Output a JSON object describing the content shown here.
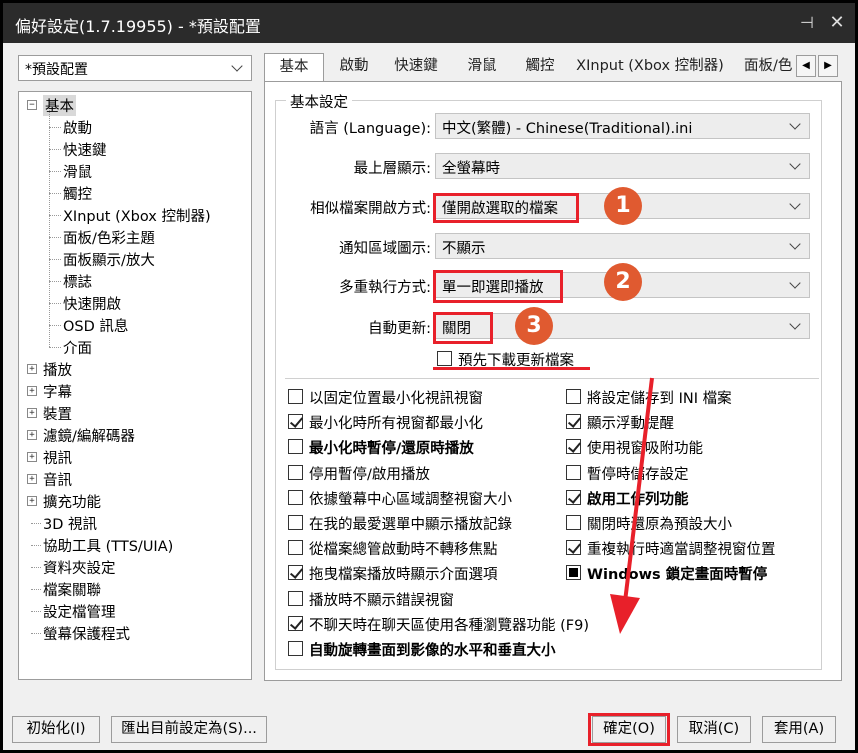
{
  "window": {
    "title": "偏好設定(1.7.19955) - *預設配置",
    "pin_glyph": "⊣",
    "close_glyph": "✕"
  },
  "profile": {
    "value": "*預設配置"
  },
  "tree": {
    "root": "基本",
    "children": [
      "啟動",
      "快速鍵",
      "滑鼠",
      "觸控",
      "XInput (Xbox 控制器)",
      "面板/色彩主題",
      "面板顯示/放大",
      "標誌",
      "快速開啟",
      "OSD 訊息",
      "介面"
    ],
    "expandable": [
      "播放",
      "字幕",
      "裝置",
      "濾鏡/編解碼器",
      "視訊",
      "音訊",
      "擴充功能"
    ],
    "leaves": [
      "3D 視訊",
      "協助工具 (TTS/UIA)",
      "資料夾設定",
      "檔案關聯",
      "設定檔管理",
      "螢幕保護程式"
    ]
  },
  "tabs": [
    "基本",
    "啟動",
    "快速鍵",
    "滑鼠",
    "觸控",
    "XInput (Xbox 控制器)",
    "面板/色"
  ],
  "tab_arrows": {
    "left": "◀",
    "right": "▶"
  },
  "group_title": "基本設定",
  "form": [
    {
      "label": "語言 (Language):",
      "value": "中文(繁體) - Chinese(Traditional).ini"
    },
    {
      "label": "最上層顯示:",
      "value": "全螢幕時"
    },
    {
      "label": "相似檔案開啟方式:",
      "value": "僅開啟選取的檔案"
    },
    {
      "label": "通知區域圖示:",
      "value": "不顯示"
    },
    {
      "label": "多重執行方式:",
      "value": "單一即選即播放"
    },
    {
      "label": "自動更新:",
      "value": "關閉"
    }
  ],
  "predownload": {
    "label": "預先下載更新檔案",
    "checked": false
  },
  "checkboxes_left": [
    {
      "label": "以固定位置最小化視訊視窗",
      "state": "unchecked",
      "bold": false
    },
    {
      "label": "最小化時所有視窗都最小化",
      "state": "checked",
      "bold": false
    },
    {
      "label": "最小化時暫停/還原時播放",
      "state": "unchecked",
      "bold": true
    },
    {
      "label": "停用暫停/啟用播放",
      "state": "unchecked",
      "bold": false
    },
    {
      "label": "依據螢幕中心區域調整視窗大小",
      "state": "unchecked",
      "bold": false
    },
    {
      "label": "在我的最愛選單中顯示播放記錄",
      "state": "unchecked",
      "bold": false
    },
    {
      "label": "從檔案總管啟動時不轉移焦點",
      "state": "unchecked",
      "bold": false
    },
    {
      "label": "拖曳檔案播放時顯示介面選項",
      "state": "checked",
      "bold": false
    },
    {
      "label": "播放時不顯示錯誤視窗",
      "state": "unchecked",
      "bold": false
    },
    {
      "label": "不聊天時在聊天區使用各種瀏覽器功能 (F9)",
      "state": "checked",
      "bold": false
    },
    {
      "label": "自動旋轉畫面到影像的水平和垂直大小",
      "state": "unchecked",
      "bold": true
    }
  ],
  "checkboxes_right": [
    {
      "label": "將設定儲存到 INI 檔案",
      "state": "unchecked",
      "bold": false
    },
    {
      "label": "顯示浮動提醒",
      "state": "checked",
      "bold": false
    },
    {
      "label": "使用視窗吸附功能",
      "state": "checked",
      "bold": false
    },
    {
      "label": "暫停時儲存設定",
      "state": "unchecked",
      "bold": false
    },
    {
      "label": "啟用工作列功能",
      "state": "checked",
      "bold": true
    },
    {
      "label": "關閉時還原為預設大小",
      "state": "unchecked",
      "bold": false
    },
    {
      "label": "重複執行時適當調整視窗位置",
      "state": "checked",
      "bold": false
    },
    {
      "label": "Windows 鎖定畫面時暫停",
      "state": "filled",
      "bold": true
    }
  ],
  "buttons": {
    "init": "初始化(I)",
    "export": "匯出目前設定為(S)...",
    "ok": "確定(O)",
    "cancel": "取消(C)",
    "apply": "套用(A)"
  },
  "annotations": {
    "badges": [
      "1",
      "2",
      "3"
    ],
    "accent": "#e8202a",
    "badge_color": "#e05a30"
  }
}
